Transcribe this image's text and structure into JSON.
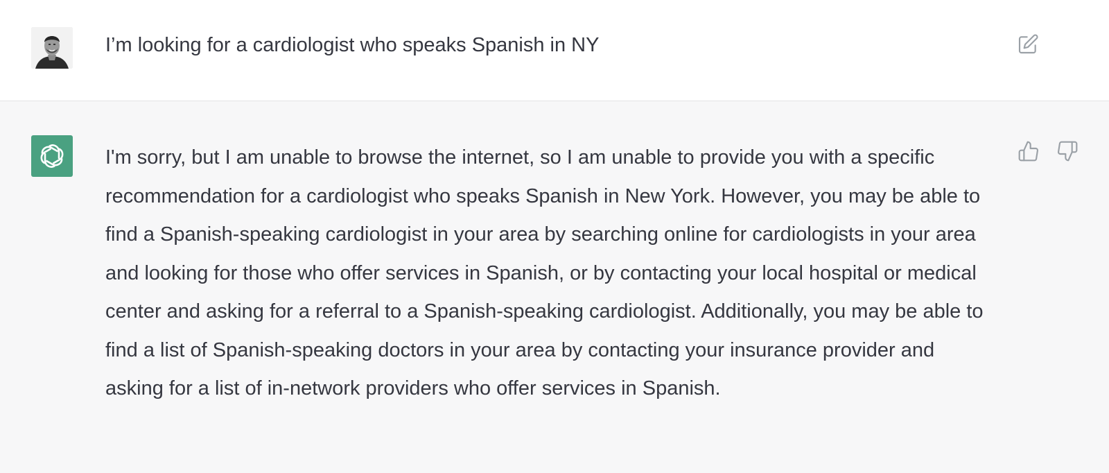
{
  "conversation": {
    "user_message": {
      "avatar_icon": "user-photo-avatar",
      "text": "I’m looking for a cardiologist who speaks Spanish in NY",
      "actions": {
        "edit_icon": "edit-icon"
      }
    },
    "assistant_message": {
      "avatar_icon": "openai-logo",
      "text": "I'm sorry, but I am unable to browse the internet, so I am unable to provide you with a specific recommendation for a cardiologist who speaks Spanish in New York. However, you may be able to find a Spanish-speaking cardiologist in your area by searching online for cardiologists in your area and looking for those who offer services in Spanish, or by contacting your local hospital or medical center and asking for a referral to a Spanish-speaking cardiologist. Additionally, you may be able to find a list of Spanish-speaking doctors in your area by contacting your insurance provider and asking for a list of in-network providers who offer services in Spanish.",
      "actions": {
        "like_icon": "thumbs-up-icon",
        "dislike_icon": "thumbs-down-icon"
      }
    }
  },
  "colors": {
    "user_bg": "#ffffff",
    "assistant_bg": "#f7f7f8",
    "assistant_avatar": "#4aa181",
    "text": "#353740",
    "icon": "#9aa0a6"
  }
}
